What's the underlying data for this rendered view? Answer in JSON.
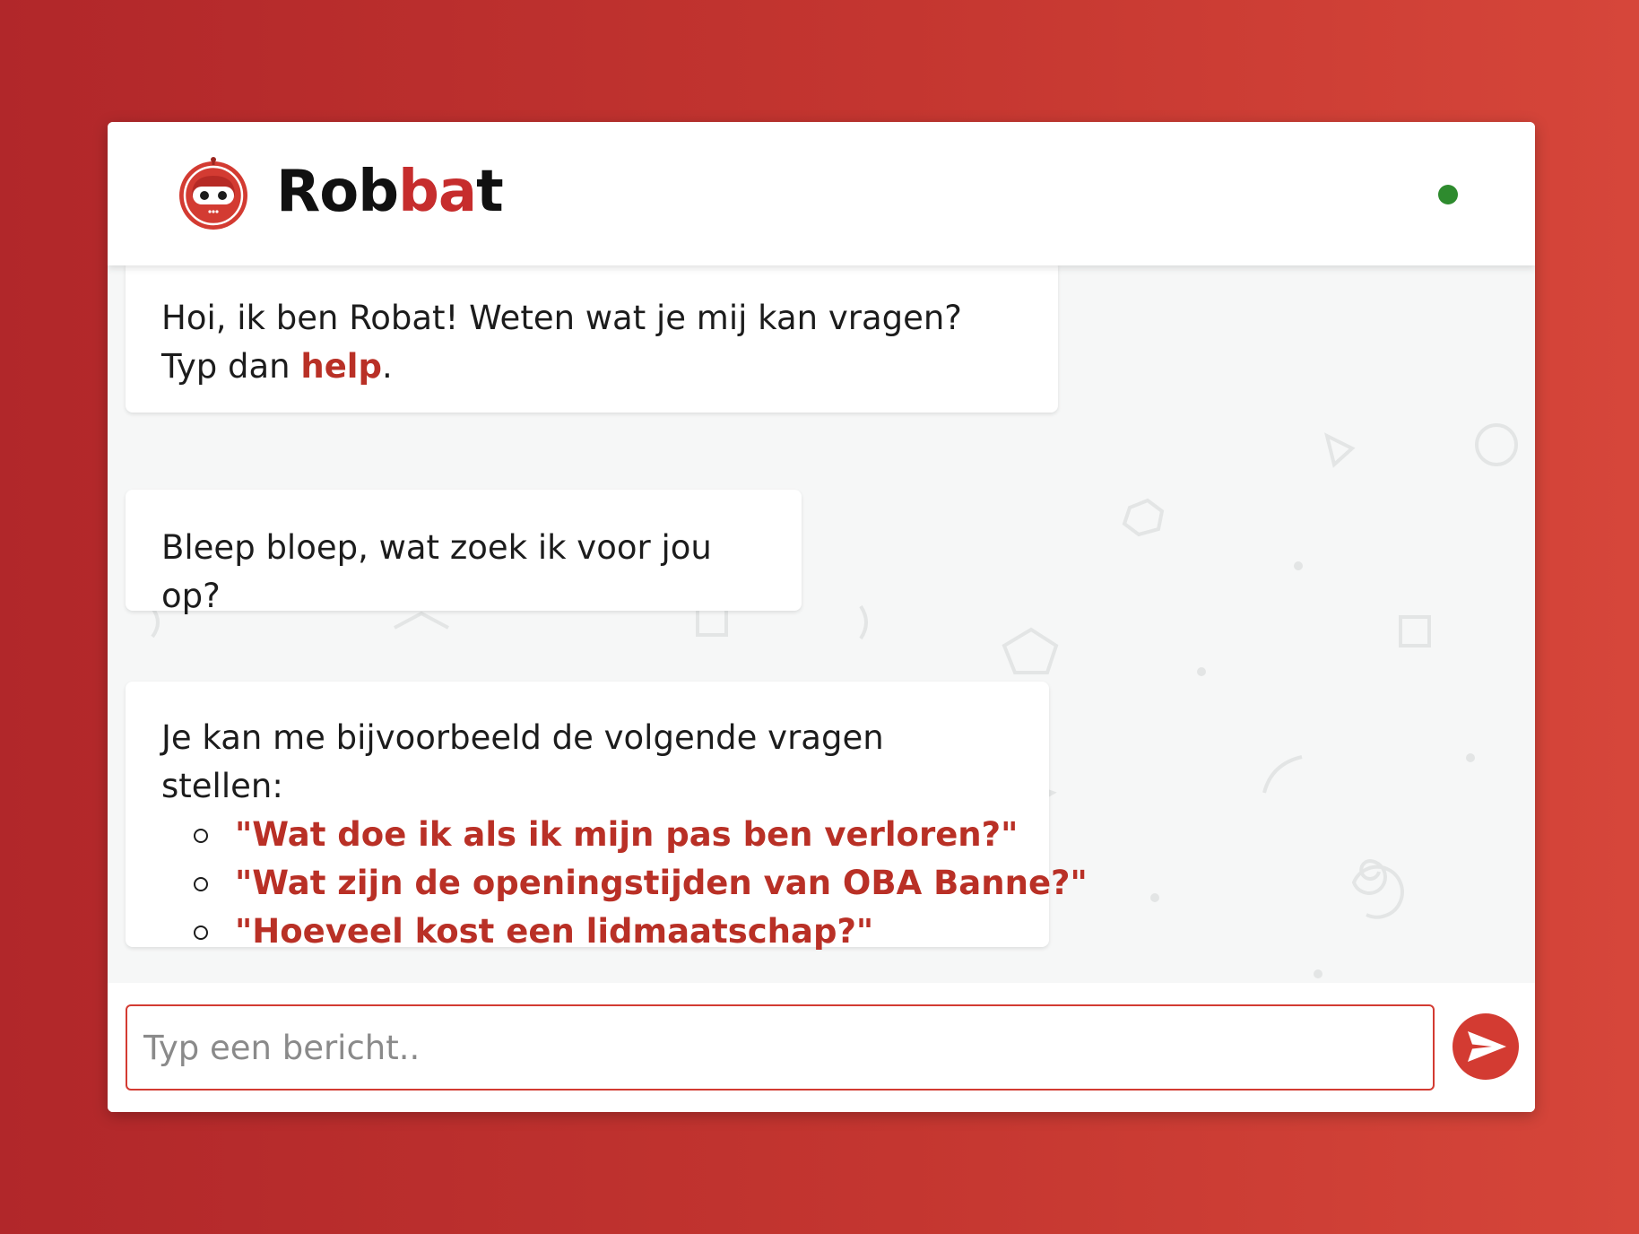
{
  "header": {
    "brand_name_part1": "Rob",
    "brand_name_part2": "b",
    "brand_name_part3": "a",
    "brand_name_part4": "t",
    "avatar_icon": "robot-icon",
    "status_color": "#2e8b2e"
  },
  "messages": [
    {
      "text_before": "Hoi, ik ben Robat! Weten wat je mij kan vragen? Typ dan ",
      "link": "help",
      "text_after": "."
    },
    {
      "text": "Bleep bloep, wat zoek ik voor jou op?"
    },
    {
      "intro": "Je kan me bijvoorbeeld de volgende vragen stellen:",
      "suggestions": [
        "\"Wat doe ik als ik mijn pas ben verloren?\"",
        "\"Wat zijn de openingstijden van OBA Banne?\"",
        "\"Hoeveel kost een lidmaatschap?\""
      ]
    }
  ],
  "composer": {
    "placeholder": "Typ een bericht..",
    "send_icon": "send-icon"
  },
  "colors": {
    "accent": "#c62d2d",
    "link": "#b93026",
    "background_gradient_start": "#b1272a",
    "background_gradient_end": "#d6463a"
  }
}
